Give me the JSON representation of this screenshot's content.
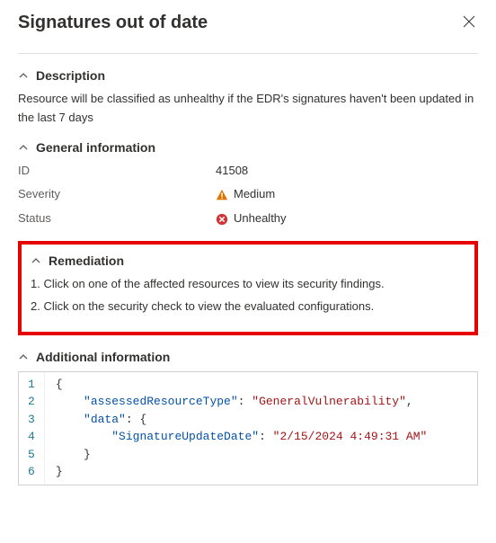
{
  "header": {
    "title": "Signatures out of date"
  },
  "sections": {
    "description": {
      "title": "Description",
      "body": "Resource will be classified as unhealthy if the EDR's signatures haven't been updated in the last 7 days"
    },
    "general": {
      "title": "General information",
      "id_label": "ID",
      "id_value": "41508",
      "severity_label": "Severity",
      "severity_value": "Medium",
      "status_label": "Status",
      "status_value": "Unhealthy"
    },
    "remediation": {
      "title": "Remediation",
      "step1": "1. Click on one of the affected resources to view its security findings.",
      "step2": "2. Click on the security check to view the evaluated configurations."
    },
    "additional": {
      "title": "Additional information",
      "json": {
        "assessedResourceType": "GeneralVulnerability",
        "data": {
          "SignatureUpdateDate": "2/15/2024 4:49:31 AM"
        }
      },
      "render": {
        "line1": "{",
        "k1": "\"assessedResourceType\"",
        "v1": "\"GeneralVulnerability\"",
        "k2": "\"data\"",
        "b2": "{",
        "k3": "\"SignatureUpdateDate\"",
        "v3": "\"2/15/2024 4:49:31 AM\"",
        "line5": "}",
        "line6": "}",
        "ln1": "1",
        "ln2": "2",
        "ln3": "3",
        "ln4": "4",
        "ln5": "5",
        "ln6": "6"
      }
    }
  }
}
